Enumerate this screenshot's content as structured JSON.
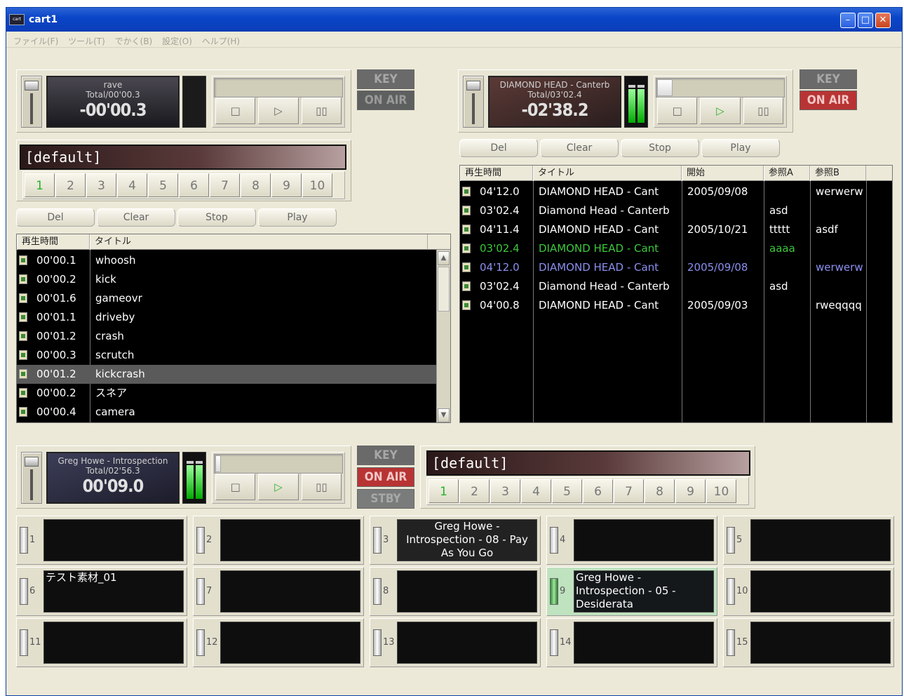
{
  "window": {
    "title": "cart1",
    "icon_text": "cart"
  },
  "menu": [
    "ファイル(F)",
    "ツール(T)",
    "でかく(B)",
    "設定(O)",
    "ヘルプ(H)"
  ],
  "player_a": {
    "name": "rave",
    "total": "Total/00'00.3",
    "time": "-00'00.3",
    "key": "KEY",
    "onair": "ON AIR"
  },
  "player_b": {
    "name": "DIAMOND HEAD - Canterb",
    "total": "Total/03'02.4",
    "time": "-02'38.2",
    "key": "KEY",
    "onair": "ON AIR"
  },
  "player_c": {
    "name": "Greg Howe - Introspection",
    "total": "Total/02'56.3",
    "time": "00'09.0",
    "key": "KEY",
    "onair": "ON AIR",
    "stby": "STBY"
  },
  "bank_top": {
    "label": "[default]",
    "pages": [
      "1",
      "2",
      "3",
      "4",
      "5",
      "6",
      "7",
      "8",
      "9",
      "10"
    ],
    "selected": "1"
  },
  "bank_bottom": {
    "label": "[default]",
    "pages": [
      "1",
      "2",
      "3",
      "4",
      "5",
      "6",
      "7",
      "8",
      "9",
      "10"
    ],
    "selected": "1"
  },
  "actions_left": {
    "del": "Del",
    "clear": "Clear",
    "stop": "Stop",
    "play": "Play"
  },
  "actions_right": {
    "del": "Del",
    "clear": "Clear",
    "stop": "Stop",
    "play": "Play"
  },
  "left_list": {
    "columns": [
      "再生時間",
      "タイトル"
    ],
    "rows": [
      {
        "time": "00'00.1",
        "title": "whoosh"
      },
      {
        "time": "00'00.2",
        "title": "kick"
      },
      {
        "time": "00'01.6",
        "title": "gameovr"
      },
      {
        "time": "00'01.1",
        "title": "driveby"
      },
      {
        "time": "00'01.2",
        "title": "crash"
      },
      {
        "time": "00'00.3",
        "title": "scrutch"
      },
      {
        "time": "00'01.2",
        "title": "kickcrash"
      },
      {
        "time": "00'00.2",
        "title": "スネア"
      },
      {
        "time": "00'00.4",
        "title": "camera"
      }
    ]
  },
  "right_list": {
    "columns": [
      "再生時間",
      "タイトル",
      "開始",
      "参照A",
      "参照B"
    ],
    "rows": [
      {
        "time": "04'12.0",
        "title": "DIAMOND HEAD - Cant",
        "start": "2005/09/08",
        "refA": "",
        "refB": "werwerw"
      },
      {
        "time": "03'02.4",
        "title": "Diamond Head - Canterb",
        "start": "",
        "refA": "asd",
        "refB": ""
      },
      {
        "time": "04'11.4",
        "title": "DIAMOND HEAD - Cant",
        "start": "2005/10/21",
        "refA": "ttttt",
        "refB": "asdf"
      },
      {
        "time": "03'02.4",
        "title": "DIAMOND HEAD - Cant",
        "start": "",
        "refA": "aaaa",
        "refB": ""
      },
      {
        "time": "04'12.0",
        "title": "DIAMOND HEAD - Cant",
        "start": "2005/09/08",
        "refA": "",
        "refB": "werwerw"
      },
      {
        "time": "03'02.4",
        "title": "Diamond Head - Canterb",
        "start": "",
        "refA": "asd",
        "refB": ""
      },
      {
        "time": "04'00.8",
        "title": "DIAMOND HEAD - Cant",
        "start": "2005/09/03",
        "refA": "",
        "refB": "rweqqqq"
      }
    ]
  },
  "carts": [
    {
      "num": "1",
      "text": ""
    },
    {
      "num": "2",
      "text": ""
    },
    {
      "num": "3",
      "text": "Greg Howe - Introspection - 08 - Pay As You Go"
    },
    {
      "num": "4",
      "text": ""
    },
    {
      "num": "5",
      "text": ""
    },
    {
      "num": "6",
      "text": "テスト素材_01"
    },
    {
      "num": "7",
      "text": ""
    },
    {
      "num": "8",
      "text": ""
    },
    {
      "num": "9",
      "text": "Greg Howe - Introspection - 05 - Desiderata"
    },
    {
      "num": "10",
      "text": ""
    },
    {
      "num": "11",
      "text": ""
    },
    {
      "num": "12",
      "text": ""
    },
    {
      "num": "13",
      "text": ""
    },
    {
      "num": "14",
      "text": ""
    },
    {
      "num": "15",
      "text": ""
    }
  ]
}
